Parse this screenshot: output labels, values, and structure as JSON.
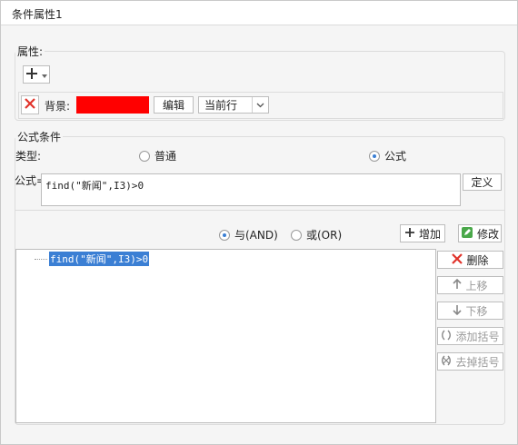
{
  "window": {
    "title": "条件属性1"
  },
  "attributes": {
    "legend": "属性:",
    "add_icon": "plus-dropdown-icon",
    "row": {
      "delete_icon": "red-x-icon",
      "label": "背景:",
      "color": "#ff0000",
      "edit_label": "编辑",
      "scope_value": "当前行"
    }
  },
  "formula_condition": {
    "legend": "公式条件",
    "type_label": "类型:",
    "type_options": {
      "normal": "普通",
      "formula": "公式"
    },
    "formula_label": "公式=",
    "formula_value": "find(\"新闻\",I3)>0",
    "define_label": "定义",
    "and_label": "与(AND)",
    "or_label": "或(OR)",
    "add_label": "增加",
    "modify_label": "修改",
    "conditions": [
      "find(\"新闻\",I3)>0"
    ],
    "actions": {
      "delete": "删除",
      "move_up": "上移",
      "move_down": "下移",
      "add_paren": "添加括号",
      "remove_paren": "去掉括号"
    }
  }
}
